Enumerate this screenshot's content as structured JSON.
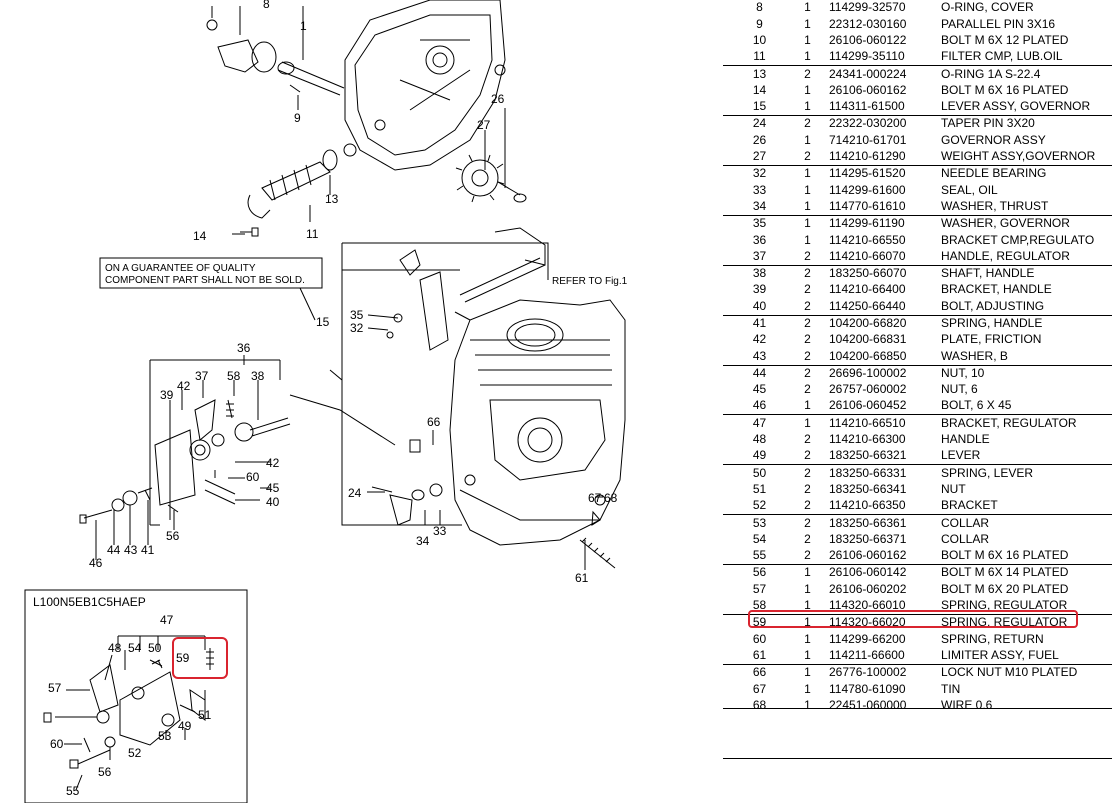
{
  "diagram": {
    "note_lines": [
      "ON A GUARANTEE OF QUALITY",
      "COMPONENT PART SHALL NOT BE SOLD."
    ],
    "refer_label": "REFER TO Fig.1",
    "inset_title": "L100N5EB1C5HAEP",
    "callouts": [
      "8",
      "1",
      "9",
      "26",
      "27",
      "13",
      "11",
      "14",
      "15",
      "35",
      "32",
      "36",
      "39",
      "42",
      "37",
      "58",
      "38",
      "60",
      "42",
      "45",
      "40",
      "66",
      "24",
      "67",
      "68",
      "34",
      "33",
      "61",
      "46",
      "44",
      "43",
      "41",
      "56",
      "47",
      "48",
      "54",
      "50",
      "59",
      "57",
      "60",
      "52",
      "53",
      "49",
      "51",
      "56",
      "55"
    ],
    "highlight_color": "#d9242f"
  },
  "parts_table": {
    "rows": [
      {
        "ref": "8",
        "qty": "1",
        "pn": "114299-32570",
        "desc": "O-RING, COVER",
        "group_start": false
      },
      {
        "ref": "9",
        "qty": "1",
        "pn": "22312-030160",
        "desc": "PARALLEL PIN 3X16",
        "group_start": false
      },
      {
        "ref": "10",
        "qty": "1",
        "pn": "26106-060122",
        "desc": "BOLT M 6X 12 PLATED",
        "group_start": false
      },
      {
        "ref": "11",
        "qty": "1",
        "pn": "114299-35110",
        "desc": "FILTER CMP, LUB.OIL",
        "group_start": false
      },
      {
        "ref": "13",
        "qty": "2",
        "pn": "24341-000224",
        "desc": "O-RING 1A S-22.4",
        "group_start": true
      },
      {
        "ref": "14",
        "qty": "1",
        "pn": "26106-060162",
        "desc": "BOLT M 6X 16 PLATED",
        "group_start": false
      },
      {
        "ref": "15",
        "qty": "1",
        "pn": "114311-61500",
        "desc": "LEVER ASSY, GOVERNOR",
        "group_start": false
      },
      {
        "ref": "24",
        "qty": "2",
        "pn": "22322-030200",
        "desc": "TAPER PIN 3X20",
        "group_start": true
      },
      {
        "ref": "26",
        "qty": "1",
        "pn": "714210-61701",
        "desc": "GOVERNOR ASSY",
        "group_start": false
      },
      {
        "ref": "27",
        "qty": "2",
        "pn": "114210-61290",
        "desc": "WEIGHT ASSY,GOVERNOR",
        "group_start": false
      },
      {
        "ref": "32",
        "qty": "1",
        "pn": "114295-61520",
        "desc": "NEEDLE BEARING",
        "group_start": true
      },
      {
        "ref": "33",
        "qty": "1",
        "pn": "114299-61600",
        "desc": "SEAL, OIL",
        "group_start": false
      },
      {
        "ref": "34",
        "qty": "1",
        "pn": "114770-61610",
        "desc": "WASHER, THRUST",
        "group_start": false
      },
      {
        "ref": "35",
        "qty": "1",
        "pn": "114299-61190",
        "desc": "WASHER, GOVERNOR",
        "group_start": true
      },
      {
        "ref": "36",
        "qty": "1",
        "pn": "114210-66550",
        "desc": "BRACKET CMP,REGULATO",
        "group_start": false
      },
      {
        "ref": "37",
        "qty": "2",
        "pn": "114210-66070",
        "desc": "HANDLE, REGULATOR",
        "group_start": false
      },
      {
        "ref": "38",
        "qty": "2",
        "pn": "183250-66070",
        "desc": "SHAFT, HANDLE",
        "group_start": true
      },
      {
        "ref": "39",
        "qty": "2",
        "pn": "114210-66400",
        "desc": "BRACKET, HANDLE",
        "group_start": false
      },
      {
        "ref": "40",
        "qty": "2",
        "pn": "114250-66440",
        "desc": "BOLT, ADJUSTING",
        "group_start": false
      },
      {
        "ref": "41",
        "qty": "2",
        "pn": "104200-66820",
        "desc": "SPRING, HANDLE",
        "group_start": true
      },
      {
        "ref": "42",
        "qty": "2",
        "pn": "104200-66831",
        "desc": "PLATE, FRICTION",
        "group_start": false
      },
      {
        "ref": "43",
        "qty": "2",
        "pn": "104200-66850",
        "desc": "WASHER, B",
        "group_start": false
      },
      {
        "ref": "44",
        "qty": "2",
        "pn": "26696-100002",
        "desc": "NUT, 10",
        "group_start": true
      },
      {
        "ref": "45",
        "qty": "2",
        "pn": "26757-060002",
        "desc": "NUT,  6",
        "group_start": false
      },
      {
        "ref": "46",
        "qty": "1",
        "pn": "26106-060452",
        "desc": "BOLT,    6 X  45",
        "group_start": false
      },
      {
        "ref": "47",
        "qty": "1",
        "pn": "114210-66510",
        "desc": "BRACKET, REGULATOR",
        "group_start": true
      },
      {
        "ref": "48",
        "qty": "2",
        "pn": "114210-66300",
        "desc": "HANDLE",
        "group_start": false
      },
      {
        "ref": "49",
        "qty": "2",
        "pn": "183250-66321",
        "desc": "LEVER",
        "group_start": false
      },
      {
        "ref": "50",
        "qty": "2",
        "pn": "183250-66331",
        "desc": "SPRING, LEVER",
        "group_start": true
      },
      {
        "ref": "51",
        "qty": "2",
        "pn": "183250-66341",
        "desc": "NUT",
        "group_start": false
      },
      {
        "ref": "52",
        "qty": "2",
        "pn": "114210-66350",
        "desc": "BRACKET",
        "group_start": false
      },
      {
        "ref": "53",
        "qty": "2",
        "pn": "183250-66361",
        "desc": "COLLAR",
        "group_start": true
      },
      {
        "ref": "54",
        "qty": "2",
        "pn": "183250-66371",
        "desc": "COLLAR",
        "group_start": false
      },
      {
        "ref": "55",
        "qty": "2",
        "pn": "26106-060162",
        "desc": "BOLT M 6X 16 PLATED",
        "group_start": false
      },
      {
        "ref": "56",
        "qty": "1",
        "pn": "26106-060142",
        "desc": "BOLT M 6X 14 PLATED",
        "group_start": true
      },
      {
        "ref": "57",
        "qty": "1",
        "pn": "26106-060202",
        "desc": "BOLT M 6X 20 PLATED",
        "group_start": false
      },
      {
        "ref": "58",
        "qty": "1",
        "pn": "114320-66010",
        "desc": "SPRING, REGULATOR",
        "group_start": false
      },
      {
        "ref": "59",
        "qty": "1",
        "pn": "114320-66020",
        "desc": "SPRING, REGULATOR",
        "group_start": true,
        "highlight": true
      },
      {
        "ref": "60",
        "qty": "1",
        "pn": "114299-66200",
        "desc": "SPRING, RETURN",
        "group_start": false
      },
      {
        "ref": "61",
        "qty": "1",
        "pn": "114211-66600",
        "desc": "LIMITER ASSY, FUEL",
        "group_start": false
      },
      {
        "ref": "66",
        "qty": "1",
        "pn": "26776-100002",
        "desc": "LOCK NUT M10 PLATED",
        "group_start": true
      },
      {
        "ref": "67",
        "qty": "1",
        "pn": "114780-61090",
        "desc": "TIN",
        "group_start": false
      },
      {
        "ref": "68",
        "qty": "1",
        "pn": "22451-060000",
        "desc": "WIRE 0.6",
        "group_start": false
      }
    ]
  }
}
